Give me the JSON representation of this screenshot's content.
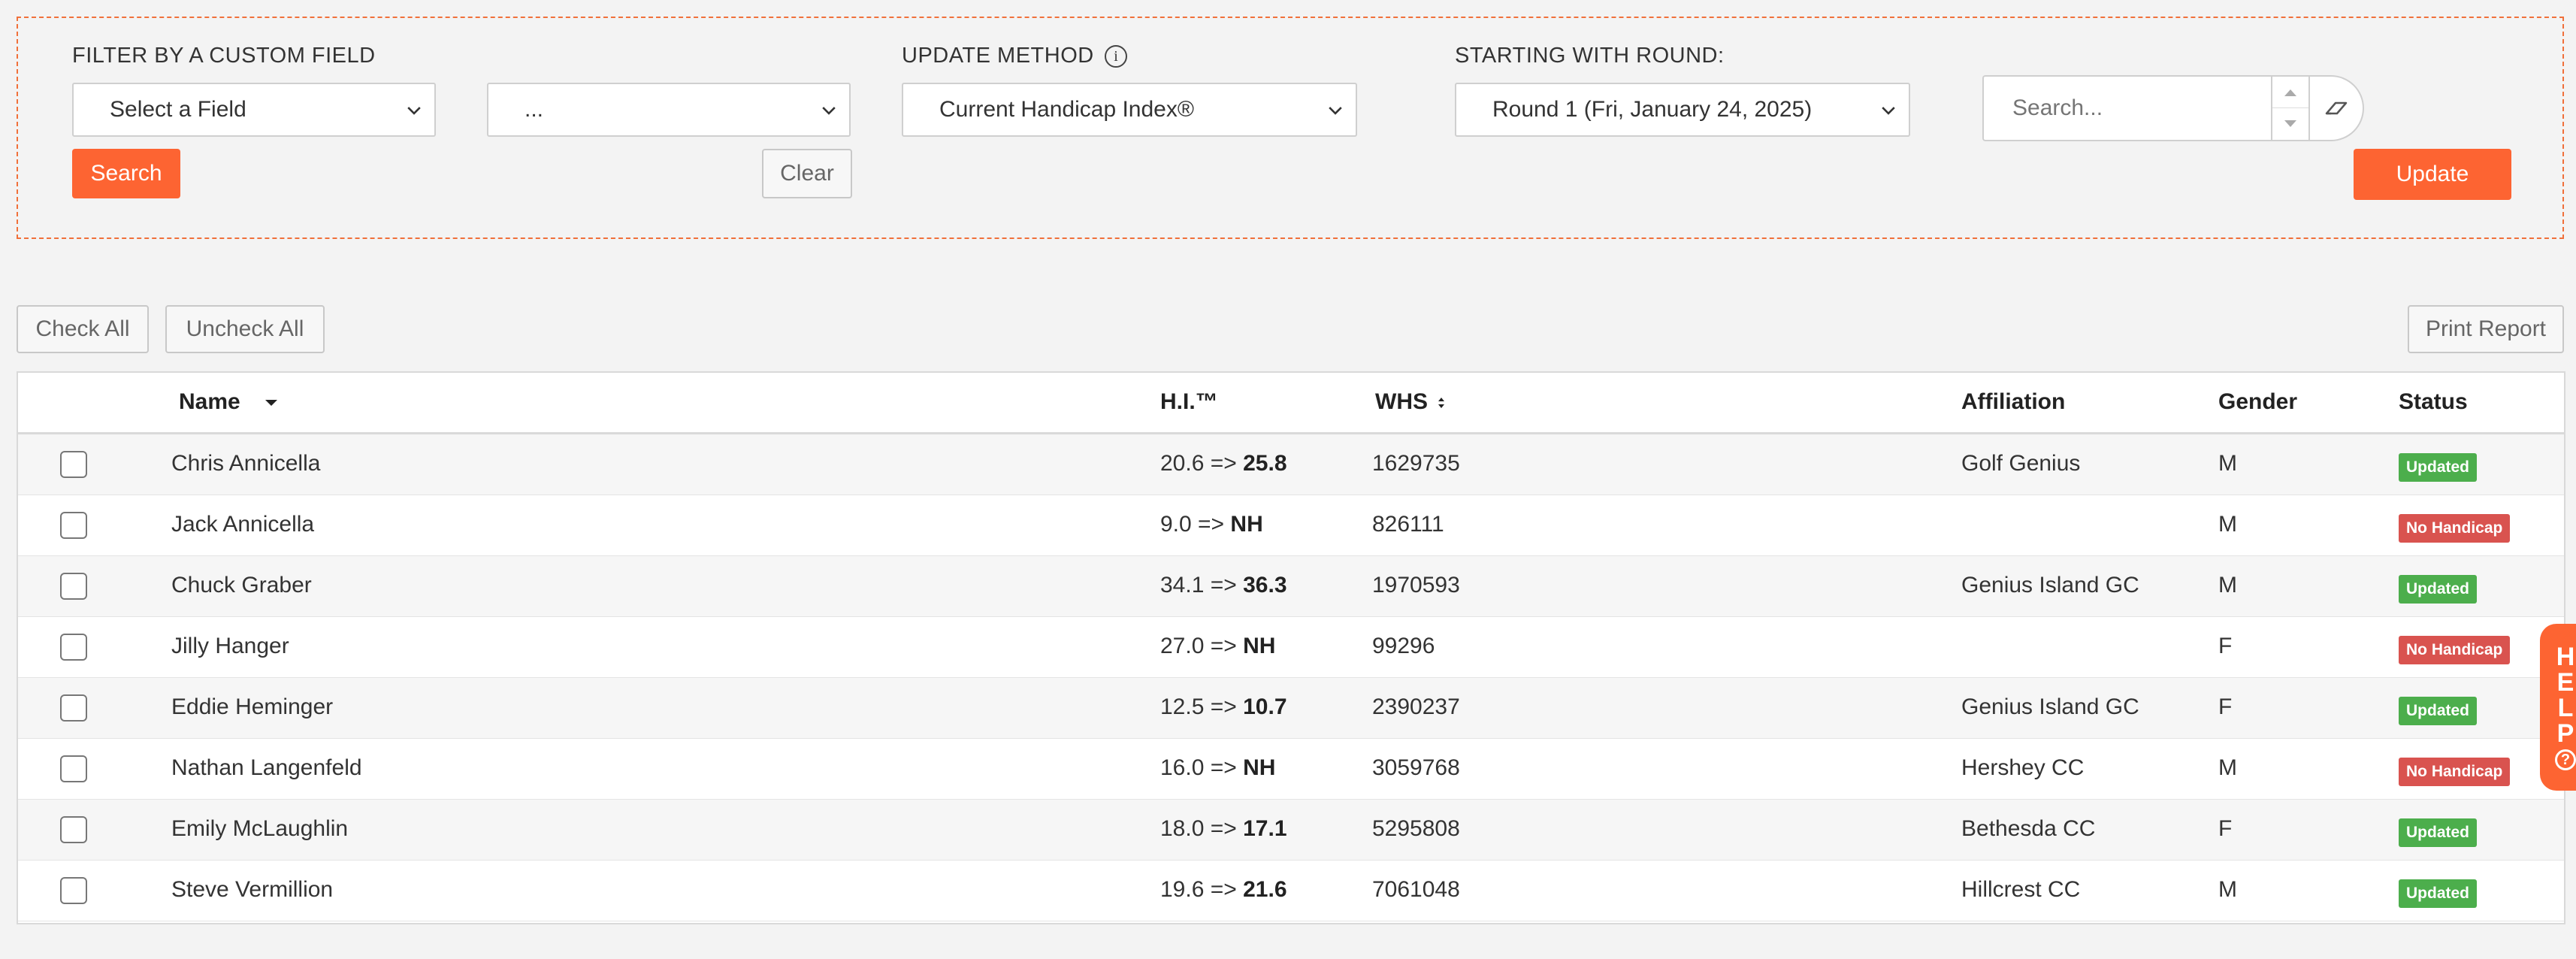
{
  "filters": {
    "custom_field_label": "FILTER BY A CUSTOM FIELD",
    "field_select_value": "Select a Field",
    "field_value_select_value": "...",
    "search_button": "Search",
    "clear_button": "Clear",
    "update_method_label": "UPDATE METHOD",
    "update_method_value": "Current Handicap Index®",
    "starting_round_label": "STARTING WITH ROUND:",
    "starting_round_value": "Round 1 (Fri, January 24, 2025)",
    "search_placeholder": "Search...",
    "update_button": "Update"
  },
  "actions": {
    "check_all": "Check All",
    "uncheck_all": "Uncheck All",
    "print_report": "Print Report"
  },
  "table": {
    "columns": {
      "name": "Name",
      "hi": "H.I.™",
      "whs": "WHS",
      "affiliation": "Affiliation",
      "gender": "Gender",
      "status": "Status"
    },
    "rows": [
      {
        "name": "Chris Annicella",
        "hi_old": "20.6 =>",
        "hi_new": "25.8",
        "whs": "1629735",
        "affiliation": "Golf Genius",
        "gender": "M",
        "status": "Updated"
      },
      {
        "name": "Jack Annicella",
        "hi_old": "9.0 =>",
        "hi_new": "NH",
        "whs": "826111",
        "affiliation": "",
        "gender": "M",
        "status": "No Handicap"
      },
      {
        "name": "Chuck Graber",
        "hi_old": "34.1 =>",
        "hi_new": "36.3",
        "whs": "1970593",
        "affiliation": "Genius Island GC",
        "gender": "M",
        "status": "Updated"
      },
      {
        "name": "Jilly Hanger",
        "hi_old": "27.0 =>",
        "hi_new": "NH",
        "whs": "99296",
        "affiliation": "",
        "gender": "F",
        "status": "No Handicap"
      },
      {
        "name": "Eddie Heminger",
        "hi_old": "12.5 =>",
        "hi_new": "10.7",
        "whs": "2390237",
        "affiliation": "Genius Island GC",
        "gender": "F",
        "status": "Updated"
      },
      {
        "name": "Nathan Langenfeld",
        "hi_old": "16.0 =>",
        "hi_new": "NH",
        "whs": "3059768",
        "affiliation": "Hershey CC",
        "gender": "M",
        "status": "No Handicap"
      },
      {
        "name": "Emily McLaughlin",
        "hi_old": "18.0 =>",
        "hi_new": "17.1",
        "whs": "5295808",
        "affiliation": "Bethesda CC",
        "gender": "F",
        "status": "Updated"
      },
      {
        "name": "Steve Vermillion",
        "hi_old": "19.6 =>",
        "hi_new": "21.6",
        "whs": "7061048",
        "affiliation": "Hillcrest CC",
        "gender": "M",
        "status": "Updated"
      }
    ]
  },
  "help_tab": {
    "letters": [
      "H",
      "E",
      "L",
      "P"
    ],
    "icon": "?"
  },
  "icons": {
    "info": "info-icon",
    "chevron": "chevron-down-icon",
    "sort": "sort-icon",
    "eraser": "eraser-icon"
  },
  "colors": {
    "accent": "#fd6432",
    "updated": "#4cae4c",
    "no_handicap": "#d9534f"
  }
}
